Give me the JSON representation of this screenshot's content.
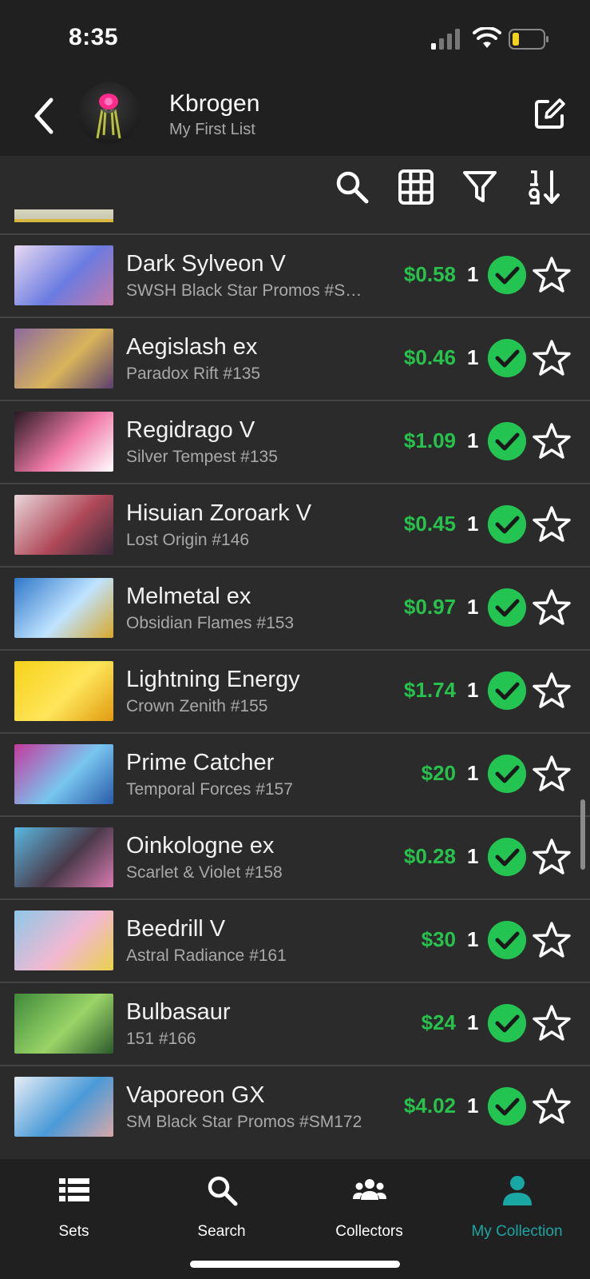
{
  "status": {
    "time": "8:35"
  },
  "header": {
    "title": "Kbrogen",
    "subtitle": "My First List"
  },
  "toolbar": {
    "icons": [
      "search-icon",
      "grid-icon",
      "filter-icon",
      "sort-numeric-icon"
    ]
  },
  "cards": [
    {
      "name": "Dark Sylveon V",
      "set": "SWSH Black Star Promos #S…",
      "price": "$0.58",
      "qty": "1",
      "colors": [
        "#e8d9f2",
        "#6a7be0",
        "#c47aa8"
      ]
    },
    {
      "name": "Aegislash ex",
      "set": "Paradox Rift #135",
      "price": "$0.46",
      "qty": "1",
      "colors": [
        "#8c6a9e",
        "#d8b45a",
        "#5a3f6e"
      ]
    },
    {
      "name": "Regidrago V",
      "set": "Silver Tempest #135",
      "price": "$1.09",
      "qty": "1",
      "colors": [
        "#2a1a22",
        "#f07aa8",
        "#ffffff"
      ]
    },
    {
      "name": "Hisuian Zoroark V",
      "set": "Lost Origin #146",
      "price": "$0.45",
      "qty": "1",
      "colors": [
        "#e9d6da",
        "#b04a5a",
        "#3a2a3a"
      ]
    },
    {
      "name": "Melmetal ex",
      "set": "Obsidian Flames #153",
      "price": "$0.97",
      "qty": "1",
      "colors": [
        "#2f78c9",
        "#bfe3ff",
        "#d8a82a"
      ]
    },
    {
      "name": "Lightning Energy",
      "set": "Crown Zenith #155",
      "price": "$1.74",
      "qty": "1",
      "colors": [
        "#f6d21a",
        "#ffe55a",
        "#e09b10"
      ]
    },
    {
      "name": "Prime Catcher",
      "set": "Temporal Forces #157",
      "price": "$20",
      "qty": "1",
      "colors": [
        "#c43a9c",
        "#78c6f0",
        "#2a5aa8"
      ]
    },
    {
      "name": "Oinkologne ex",
      "set": "Scarlet & Violet #158",
      "price": "$0.28",
      "qty": "1",
      "colors": [
        "#5ab7e0",
        "#4a3a4a",
        "#d87ab0"
      ]
    },
    {
      "name": "Beedrill V",
      "set": "Astral Radiance #161",
      "price": "$30",
      "qty": "1",
      "colors": [
        "#8ec8e8",
        "#f2b8d2",
        "#e8d24a"
      ]
    },
    {
      "name": "Bulbasaur",
      "set": "151 #166",
      "price": "$24",
      "qty": "1",
      "colors": [
        "#3e8a3a",
        "#9ad468",
        "#2a5a2a"
      ]
    },
    {
      "name": "Vaporeon GX",
      "set": "SM Black Star Promos #SM172",
      "price": "$4.02",
      "qty": "1",
      "colors": [
        "#e6eef6",
        "#4a9ad8",
        "#d8a8a8"
      ]
    }
  ],
  "nav": [
    {
      "label": "Sets",
      "icon": "list-icon",
      "active": false
    },
    {
      "label": "Search",
      "icon": "search-icon",
      "active": false
    },
    {
      "label": "Collectors",
      "icon": "people-icon",
      "active": false
    },
    {
      "label": "My Collection",
      "icon": "person-icon",
      "active": true
    }
  ],
  "colors": {
    "accent": "#1aa6a3",
    "price": "#27c24c",
    "check": "#23c451"
  }
}
